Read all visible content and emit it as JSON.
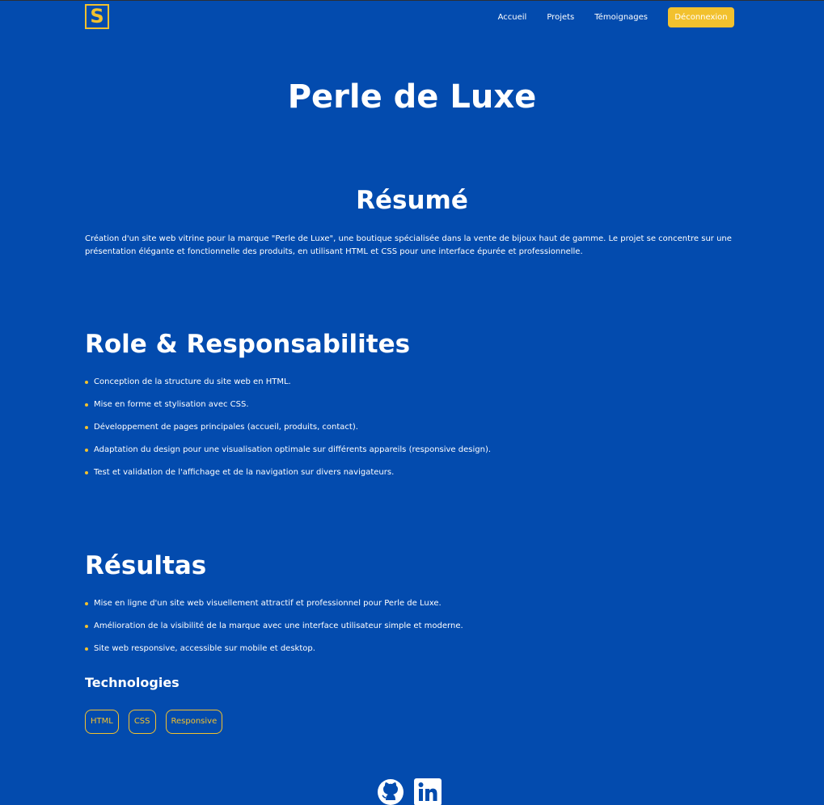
{
  "nav": {
    "logo_letter": "S",
    "links": [
      "Accueil",
      "Projets",
      "Témoignages"
    ],
    "logout_label": "Déconnexion"
  },
  "page": {
    "title": "Perle de Luxe"
  },
  "summary": {
    "heading": "Résumé",
    "text": "Création d'un site web vitrine pour la marque \"Perle de Luxe\", une boutique spécialisée dans la vente de bijoux haut de gamme. Le projet se concentre sur une présentation élégante et fonctionnelle des produits, en utilisant HTML et CSS pour une interface épurée et professionnelle."
  },
  "roles": {
    "heading": "Role & Responsabilites",
    "items": [
      "Conception de la structure du site web en HTML.",
      "Mise en forme et stylisation avec CSS.",
      "Développement de pages principales (accueil, produits, contact).",
      "Adaptation du design pour une visualisation optimale sur différents appareils (responsive design).",
      "Test et validation de l'affichage et de la navigation sur divers navigateurs."
    ]
  },
  "results": {
    "heading": "Résultas",
    "items": [
      "Mise en ligne d'un site web visuellement attractif et professionnel pour Perle de Luxe.",
      "Amélioration de la visibilité de la marque avec une interface utilisateur simple et moderne.",
      "Site web responsive, accessible sur mobile et desktop."
    ]
  },
  "technologies": {
    "heading": "Technologies",
    "tags": [
      "HTML",
      "CSS",
      "Responsive"
    ]
  },
  "footer": {
    "icons": [
      "github-icon",
      "linkedin-icon"
    ]
  },
  "colors": {
    "background": "#034bae",
    "accent": "#f2c12e",
    "text": "#ffffff"
  }
}
